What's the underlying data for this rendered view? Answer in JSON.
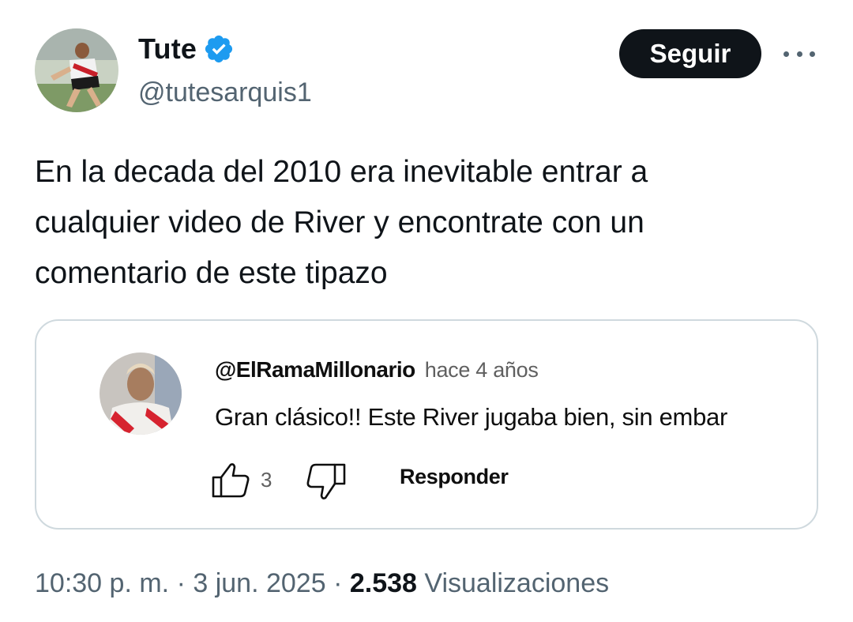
{
  "author": {
    "name": "Tute",
    "handle": "@tutesarquis1",
    "verified": true,
    "follow_label": "Seguir"
  },
  "icons": {
    "verified": "verified-badge-icon",
    "more": "more-options-icon",
    "like": "thumbs-up-icon",
    "dislike": "thumbs-down-icon"
  },
  "colors": {
    "verified": "#1d9bf0",
    "follow_button": "#0f1419",
    "secondary_text": "#536471",
    "card_border": "#cfd9de"
  },
  "tweet": {
    "text": "En la decada del 2010 era inevitable entrar a\ncualquier video de River y encontrate con un\ncomentario de este tipazo"
  },
  "quoted_comment": {
    "author": "@ElRamaMillonario",
    "time": "hace 4 años",
    "text": "Gran clásico!! Este River jugaba bien, sin embar",
    "like_count": "3",
    "reply_label": "Responder"
  },
  "meta": {
    "time": "10:30 p. m.",
    "separator": "·",
    "date": "3 jun. 2025",
    "views_count": "2.538",
    "views_label": "Visualizaciones"
  }
}
